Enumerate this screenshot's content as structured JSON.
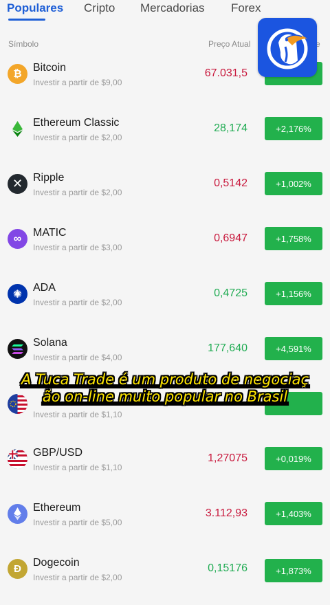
{
  "tabs": [
    "Populares",
    "Cripto",
    "Mercadorias",
    "Forex"
  ],
  "columns": {
    "symbol": "Símbolo",
    "price": "Preço Atual",
    "change_partial": "e"
  },
  "colors": {
    "accent": "#1f5fd6",
    "up_badge": "#22b14c",
    "price_red": "#c8183c",
    "price_green": "#1fab52",
    "caption": "#ffe600"
  },
  "assets": [
    {
      "name": "Bitcoin",
      "sub": "Investir a partir de $9,00",
      "price": "67.031,5",
      "change": "",
      "icon": "bitcoin-icon"
    },
    {
      "name": "Ethereum Classic",
      "sub": "Investir a partir de $2,00",
      "price": "28,174",
      "change": "+2,176%",
      "icon": "ethereum-classic-icon"
    },
    {
      "name": "Ripple",
      "sub": "Investir a partir de $2,00",
      "price": "0,5142",
      "change": "+1,002%",
      "icon": "ripple-icon"
    },
    {
      "name": "MATIC",
      "sub": "Investir a partir de $3,00",
      "price": "0,6947",
      "change": "+1,758%",
      "icon": "matic-icon"
    },
    {
      "name": "ADA",
      "sub": "Investir a partir de $2,00",
      "price": "0,4725",
      "change": "+1,156%",
      "icon": "ada-icon"
    },
    {
      "name": "Solana",
      "sub": "Investir a partir de $4,00",
      "price": "177,640",
      "change": "+4,591%",
      "icon": "solana-icon"
    },
    {
      "name": "",
      "sub": "Investir a partir de $1,10",
      "price": "",
      "change": "",
      "icon": "eur-usd-flag-icon"
    },
    {
      "name": "GBP/USD",
      "sub": "Investir a partir de $1,10",
      "price": "1,27075",
      "change": "+0,019%",
      "icon": "gbp-usd-flag-icon"
    },
    {
      "name": "Ethereum",
      "sub": "Investir a partir de $5,00",
      "price": "3.112,93",
      "change": "+1,403%",
      "icon": "ethereum-icon"
    },
    {
      "name": "Dogecoin",
      "sub": "Investir a partir de $2,00",
      "price": "0,15176",
      "change": "+1,873%",
      "icon": "dogecoin-icon"
    }
  ],
  "caption": [
    "A Tuca Trade é um produto de negociaç",
    "ão on-line muito popular no Brasil"
  ],
  "logo_icon": "toucan-logo-icon"
}
